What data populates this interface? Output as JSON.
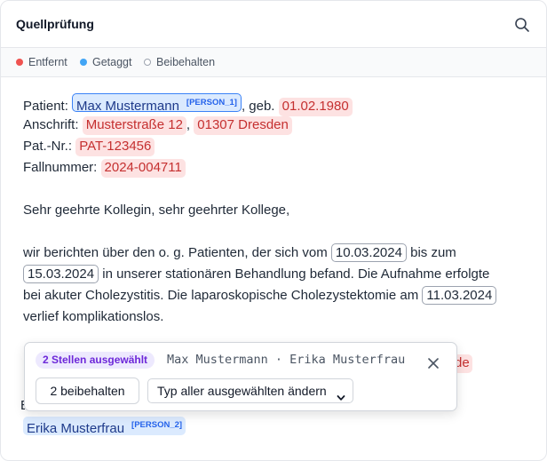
{
  "header": {
    "title": "Quellprüfung",
    "search_icon": "search-icon"
  },
  "legend": [
    {
      "label": "Entfernt",
      "color": "#ef5350",
      "style": "filled"
    },
    {
      "label": "Getaggt",
      "color": "#42a5f5",
      "style": "filled"
    },
    {
      "label": "Beibehalten",
      "color": "#9ca3af",
      "style": "outline"
    }
  ],
  "document": {
    "patient_label": "Patient:",
    "patient_name": "Max Mustermann",
    "patient_tag": "[PERSON_1]",
    "born_label": ", geb.",
    "birth_date": "01.02.1980",
    "address_label": "Anschrift:",
    "street": "Musterstraße 12",
    "comma": ",",
    "city": "01307 Dresden",
    "patnr_label": "Pat.-Nr.:",
    "patnr": "PAT-123456",
    "case_label": "Fallnummer:",
    "case_nr": "2024-004711",
    "salutation": "Sehr geehrte Kollegin, sehr geehrter Kollege,",
    "p1_a": "wir berichten über den o. g. Patienten, der sich vom",
    "date_from": "10.03.2024",
    "p1_b": "bis zum",
    "date_to": "15.03.2024",
    "p1_c": "in unserer stationären Behandlung befand. Die Aufnahme erfolgte",
    "p1_d": "bei akuter Cholezystitis. Die laparoskopische Cholezystektomie am",
    "date_op": "11.03.2024",
    "p1_e": "verlief komplikationslos.",
    "partial_removed": "de",
    "partial_letter": "E",
    "signer_name": "Erika Musterfrau",
    "signer_tag": "[PERSON_2]"
  },
  "popover": {
    "selection_badge": "2 Stellen ausgewählt",
    "selection_names": "Max Mustermann · Erika Musterfrau",
    "close_icon": "close-icon",
    "keep_button": "2 beibehalten",
    "type_select": "Typ aller ausgewählten ändern"
  }
}
